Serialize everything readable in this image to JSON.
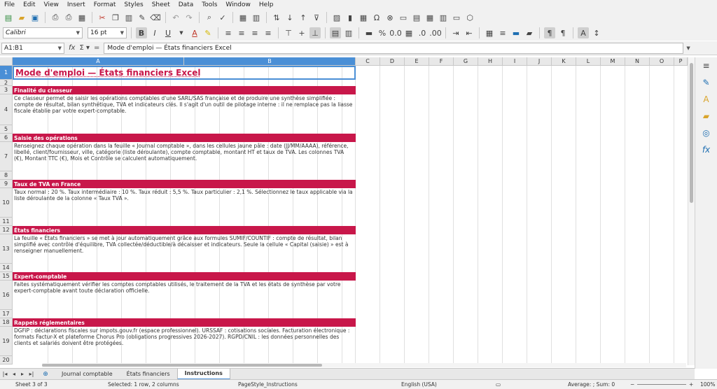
{
  "menu": [
    "File",
    "Edit",
    "View",
    "Insert",
    "Format",
    "Styles",
    "Sheet",
    "Data",
    "Tools",
    "Window",
    "Help"
  ],
  "toolbar": {
    "font_name": "Calibri",
    "font_size": "16 pt"
  },
  "formula_bar": {
    "name_box": "A1:B1",
    "content": "Mode d'emploi — États financiers Excel"
  },
  "columns": [
    "A",
    "B",
    "C",
    "D",
    "E",
    "F",
    "G",
    "H",
    "I",
    "J",
    "K",
    "L",
    "M",
    "N",
    "O",
    "P"
  ],
  "rows": [
    "1",
    "2",
    "3",
    "4",
    "5",
    "6",
    "7",
    "8",
    "9",
    "10",
    "11",
    "12",
    "13",
    "14",
    "15",
    "16",
    "17",
    "18",
    "19",
    "20"
  ],
  "sheet": {
    "title": "Mode d'emploi — États financiers Excel",
    "sections": [
      {
        "heading": "Finalité du classeur",
        "text": "Ce classeur permet de saisir les opérations comptables d'une SARL/SAS française et de produire une synthèse simplifiée : compte de résultat, bilan synthétique, TVA et indicateurs clés. Il s'agit d'un outil de pilotage interne : il ne remplace pas la liasse fiscale établie par votre expert-comptable."
      },
      {
        "heading": "Saisie des opérations",
        "text": "Renseignez chaque opération dans la feuille « Journal comptable », dans les cellules jaune pâle : date (JJ/MM/AAAA), référence, libellé, client/fournisseur, ville, catégorie (liste déroulante), compte comptable, montant HT et taux de TVA. Les colonnes TVA (€), Montant TTC (€), Mois et Contrôle se calculent automatiquement."
      },
      {
        "heading": "Taux de TVA en France",
        "text": "Taux normal : 20 %. Taux intermédiaire : 10 %. Taux réduit : 5,5 %. Taux particulier : 2,1 %. Sélectionnez le taux applicable via la liste déroulante de la colonne « Taux TVA »."
      },
      {
        "heading": "États financiers",
        "text": "La feuille « États financiers » se met à jour automatiquement grâce aux formules SUMIF/COUNTIF : compte de résultat, bilan simplifié avec contrôle d'équilibre, TVA collectée/déductible/à décaisser et indicateurs. Seule la cellule « Capital (saisie) » est à renseigner manuellement."
      },
      {
        "heading": "Expert-comptable",
        "text": "Faites systématiquement vérifier les comptes comptables utilisés, le traitement de la TVA et les états de synthèse par votre expert-comptable avant toute déclaration officielle."
      },
      {
        "heading": "Rappels réglementaires",
        "text": "DGFiP : déclarations fiscales sur impots.gouv.fr (espace professionnel). URSSAF : cotisations sociales. Facturation électronique : formats Factur-X et plateforme Chorus Pro (obligations progressives 2026-2027). RGPD/CNIL : les données personnelles des clients et salariés doivent être protégées."
      }
    ]
  },
  "tabs": [
    "Journal comptable",
    "États financiers",
    "Instructions"
  ],
  "active_tab": "Instructions",
  "status": {
    "sheet": "Sheet 3 of 3",
    "selection": "Selected: 1 row, 2 columns",
    "page_style": "PageStyle_Instructions",
    "language": "English (USA)",
    "sum": "Average: ; Sum: 0",
    "zoom": "100%"
  }
}
